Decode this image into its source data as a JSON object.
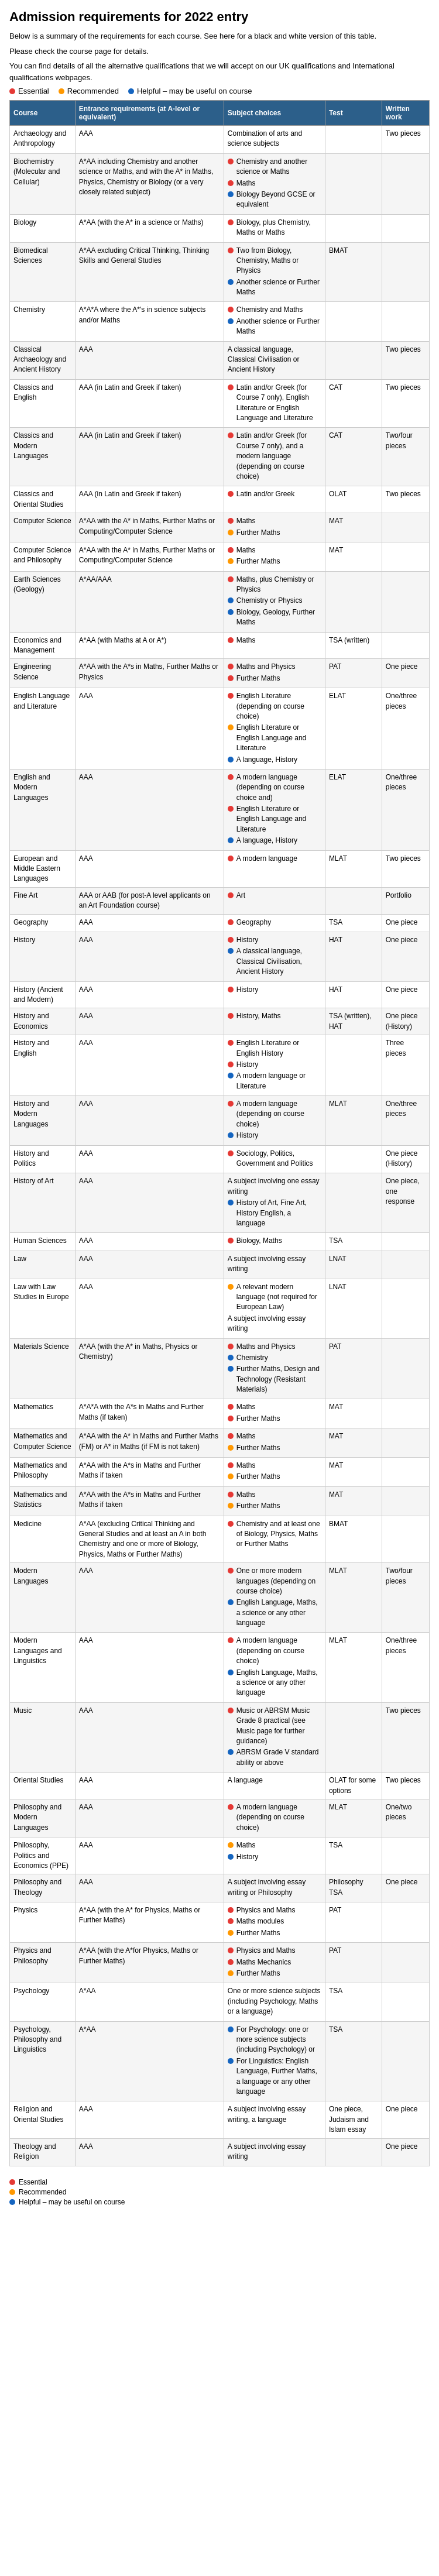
{
  "title": "Admission requirements for 2022 entry",
  "intro_lines": [
    "Below is a summary of the requirements for each course. See here for a black and white version of this table.",
    "Please check the course page for details.",
    "You can find details of all the alternative qualifications that we will accept on our UK qualifications and International qualifications webpages."
  ],
  "legend": [
    {
      "color": "red",
      "label": "Essential"
    },
    {
      "color": "orange",
      "label": "Recommended"
    },
    {
      "color": "blue",
      "label": "Helpful – may be useful on course"
    }
  ],
  "table_headers": [
    "Course",
    "Entrance requirements (at A-level or equivalent)",
    "Subject choices",
    "Test",
    "Written work"
  ],
  "rows_a": [
    {
      "course": "Archaeology and Anthropology",
      "entrance": "AAA",
      "subjects": [
        {
          "color": "none",
          "text": "Combination of arts and science subjects"
        }
      ],
      "test": "",
      "written": "Two pieces"
    },
    {
      "course": "Biochemistry (Molecular and Cellular)",
      "entrance": "A*AA including Chemistry and another science or Maths, and with the A* in Maths, Physics, Chemistry or Biology (or a very closely related subject)",
      "subjects": [
        {
          "color": "red",
          "text": "Chemistry and another science or Maths"
        },
        {
          "color": "red",
          "text": "Maths"
        },
        {
          "color": "blue",
          "text": "Biology Beyond GCSE or equivalent"
        }
      ],
      "test": "",
      "written": ""
    },
    {
      "course": "Biology",
      "entrance": "A*AA (with the A* in a science or Maths)",
      "subjects": [
        {
          "color": "red",
          "text": "Biology, plus Chemistry, Maths or Maths"
        }
      ],
      "test": "",
      "written": ""
    },
    {
      "course": "Biomedical Sciences",
      "entrance": "A*AA excluding Critical Thinking, Thinking Skills and General Studies",
      "subjects": [
        {
          "color": "red",
          "text": "Two from Biology, Chemistry, Maths or Physics"
        },
        {
          "color": "blue",
          "text": "Another science or Further Maths"
        }
      ],
      "test": "BMAT",
      "written": ""
    },
    {
      "course": "Chemistry",
      "entrance": "A*A*A where the A*'s in science subjects and/or Maths",
      "subjects": [
        {
          "color": "red",
          "text": "Chemistry and Maths"
        },
        {
          "color": "blue",
          "text": "Another science or Further Maths"
        }
      ],
      "test": "",
      "written": ""
    },
    {
      "course": "Classical Archaeology and Ancient History",
      "entrance": "AAA",
      "subjects": [
        {
          "color": "none",
          "text": "A classical language, Classical Civilisation or Ancient History"
        }
      ],
      "test": "",
      "written": "Two pieces"
    },
    {
      "course": "Classics and English",
      "entrance": "AAA (in Latin and Greek if taken)",
      "subjects": [
        {
          "color": "red",
          "text": "Latin and/or Greek (for Course 7 only), English Literature or English Language and Literature"
        }
      ],
      "test": "CAT",
      "written": "Two pieces"
    },
    {
      "course": "Classics and Modern Languages",
      "entrance": "AAA (in Latin and Greek if taken)",
      "subjects": [
        {
          "color": "red",
          "text": "Latin and/or Greek (for Course 7 only), and a modern language (depending on course choice)"
        }
      ],
      "test": "CAT",
      "written": "Two/four pieces"
    },
    {
      "course": "Classics and Oriental Studies",
      "entrance": "AAA (in Latin and Greek if taken)",
      "subjects": [
        {
          "color": "red",
          "text": "Latin and/or Greek"
        }
      ],
      "test": "OLAT",
      "written": "Two pieces"
    },
    {
      "course": "Computer Science",
      "entrance": "A*AA with the A* in Maths, Further Maths or Computing/Computer Science",
      "subjects": [
        {
          "color": "red",
          "text": "Maths"
        },
        {
          "color": "orange",
          "text": "Further Maths"
        }
      ],
      "test": "MAT",
      "written": ""
    },
    {
      "course": "Computer Science and Philosophy",
      "entrance": "A*AA with the A* in Maths, Further Maths or Computing/Computer Science",
      "subjects": [
        {
          "color": "red",
          "text": "Maths"
        },
        {
          "color": "orange",
          "text": "Further Maths"
        }
      ],
      "test": "MAT",
      "written": ""
    },
    {
      "course": "Earth Sciences (Geology)",
      "entrance": "A*AA/AAA",
      "subjects": [
        {
          "color": "red",
          "text": "Maths, plus Chemistry or Physics"
        },
        {
          "color": "blue",
          "text": "Chemistry or Physics"
        },
        {
          "color": "blue",
          "text": "Biology, Geology, Further Maths"
        }
      ],
      "test": "",
      "written": ""
    },
    {
      "course": "Economics and Management",
      "entrance": "A*AA (with Maths at A or A*)",
      "subjects": [
        {
          "color": "red",
          "text": "Maths"
        }
      ],
      "test": "TSA (written)",
      "written": ""
    },
    {
      "course": "Engineering Science",
      "entrance": "A*AA with the A*s in Maths, Further Maths or Physics",
      "subjects": [
        {
          "color": "red",
          "text": "Maths and Physics"
        },
        {
          "color": "red",
          "text": "Further Maths"
        }
      ],
      "test": "PAT",
      "written": "One piece"
    },
    {
      "course": "English Language and Literature",
      "entrance": "AAA",
      "subjects": [
        {
          "color": "red",
          "text": "English Literature (depending on course choice)"
        },
        {
          "color": "orange",
          "text": "English Literature or English Language and Literature"
        },
        {
          "color": "blue",
          "text": "A language, History"
        }
      ],
      "test": "ELAT",
      "written": "One/three pieces"
    },
    {
      "course": "English and Modern Languages",
      "entrance": "AAA",
      "subjects": [
        {
          "color": "red",
          "text": "A modern language (depending on course choice and)"
        },
        {
          "color": "red",
          "text": "English Literature or English Language and Literature"
        },
        {
          "color": "blue",
          "text": "A language, History"
        }
      ],
      "test": "ELAT",
      "written": "One/three pieces"
    },
    {
      "course": "European and Middle Eastern Languages",
      "entrance": "AAA",
      "subjects": [
        {
          "color": "red",
          "text": "A modern language"
        }
      ],
      "test": "MLAT",
      "written": "Two pieces"
    },
    {
      "course": "Fine Art",
      "entrance": "AAA or AAB (for post-A level applicants on an Art Foundation course)",
      "subjects": [
        {
          "color": "red",
          "text": "Art"
        }
      ],
      "test": "",
      "written": "Portfolio"
    },
    {
      "course": "Geography",
      "entrance": "AAA",
      "subjects": [
        {
          "color": "red",
          "text": "Geography"
        }
      ],
      "test": "TSA",
      "written": "One piece"
    },
    {
      "course": "History",
      "entrance": "AAA",
      "subjects": [
        {
          "color": "red",
          "text": "History"
        },
        {
          "color": "blue",
          "text": "A classical language, Classical Civilisation, Ancient History"
        }
      ],
      "test": "HAT",
      "written": "One piece"
    },
    {
      "course": "History (Ancient and Modern)",
      "entrance": "AAA",
      "subjects": [
        {
          "color": "red",
          "text": "History"
        }
      ],
      "test": "HAT",
      "written": "One piece"
    },
    {
      "course": "History and Economics",
      "entrance": "AAA",
      "subjects": [
        {
          "color": "red",
          "text": "History, Maths"
        }
      ],
      "test": "TSA (written), HAT",
      "written": "One piece (History)"
    },
    {
      "course": "History and English",
      "entrance": "AAA",
      "subjects": [
        {
          "color": "red",
          "text": "English Literature or English History"
        },
        {
          "color": "red",
          "text": "History"
        },
        {
          "color": "blue",
          "text": "A modern language or Literature"
        }
      ],
      "test": "",
      "written": "Three pieces"
    },
    {
      "course": "History and Modern Languages",
      "entrance": "AAA",
      "subjects": [
        {
          "color": "red",
          "text": "A modern language (depending on course choice)"
        },
        {
          "color": "blue",
          "text": "History"
        }
      ],
      "test": "MLAT",
      "written": "One/three pieces"
    },
    {
      "course": "History and Politics",
      "entrance": "AAA",
      "subjects": [
        {
          "color": "red",
          "text": "Sociology, Politics, Government and Politics"
        }
      ],
      "test": "",
      "written": "One piece (History)"
    },
    {
      "course": "History of Art",
      "entrance": "AAA",
      "subjects": [
        {
          "color": "none",
          "text": "A subject involving one essay writing"
        },
        {
          "color": "blue",
          "text": "History of Art, Fine Art, History English, a language"
        }
      ],
      "test": "",
      "written": "One piece, one response"
    },
    {
      "course": "Human Sciences",
      "entrance": "AAA",
      "subjects": [
        {
          "color": "red",
          "text": "Biology, Maths"
        }
      ],
      "test": "TSA",
      "written": ""
    }
  ],
  "rows_b": [
    {
      "course": "Law",
      "entrance": "AAA",
      "subjects": [
        {
          "color": "none",
          "text": "A subject involving essay writing"
        }
      ],
      "test": "LNAT",
      "written": ""
    },
    {
      "course": "Law with Law Studies in Europe",
      "entrance": "AAA",
      "subjects": [
        {
          "color": "orange",
          "text": "A relevant modern language (not required for European Law)"
        },
        {
          "color": "none",
          "text": "A subject involving essay writing"
        }
      ],
      "test": "LNAT",
      "written": ""
    },
    {
      "course": "Materials Science",
      "entrance": "A*AA (with the A* in Maths, Physics or Chemistry)",
      "subjects": [
        {
          "color": "red",
          "text": "Maths and Physics"
        },
        {
          "color": "blue",
          "text": "Chemistry"
        },
        {
          "color": "blue",
          "text": "Further Maths, Design and Technology (Resistant Materials)"
        }
      ],
      "test": "PAT",
      "written": ""
    },
    {
      "course": "Mathematics",
      "entrance": "A*A*A with the A*s in Maths and Further Maths (if taken)",
      "subjects": [
        {
          "color": "red",
          "text": "Maths"
        },
        {
          "color": "red",
          "text": "Further Maths"
        }
      ],
      "test": "MAT",
      "written": ""
    },
    {
      "course": "Mathematics and Computer Science",
      "entrance": "A*AA with the A* in Maths and Further Maths (FM) or A* in Maths (if FM is not taken)",
      "subjects": [
        {
          "color": "red",
          "text": "Maths"
        },
        {
          "color": "orange",
          "text": "Further Maths"
        }
      ],
      "test": "MAT",
      "written": ""
    },
    {
      "course": "Mathematics and Philosophy",
      "entrance": "A*AA with the A*s in Maths and Further Maths if taken",
      "subjects": [
        {
          "color": "red",
          "text": "Maths"
        },
        {
          "color": "orange",
          "text": "Further Maths"
        }
      ],
      "test": "MAT",
      "written": ""
    },
    {
      "course": "Mathematics and Statistics",
      "entrance": "A*AA with the A*s in Maths and Further Maths if taken",
      "subjects": [
        {
          "color": "red",
          "text": "Maths"
        },
        {
          "color": "orange",
          "text": "Further Maths"
        }
      ],
      "test": "MAT",
      "written": ""
    },
    {
      "course": "Medicine",
      "entrance": "A*AA (excluding Critical Thinking and General Studies and at least an A in both Chemistry and one or more of Biology, Physics, Maths or Further Maths)",
      "subjects": [
        {
          "color": "red",
          "text": "Chemistry and at least one of Biology, Physics, Maths or Further Maths"
        }
      ],
      "test": "BMAT",
      "written": ""
    },
    {
      "course": "Modern Languages",
      "entrance": "AAA",
      "subjects": [
        {
          "color": "red",
          "text": "One or more modern languages (depending on course choice)"
        },
        {
          "color": "blue",
          "text": "English Language, Maths, a science or any other language"
        }
      ],
      "test": "MLAT",
      "written": "Two/four pieces"
    },
    {
      "course": "Modern Languages and Linguistics",
      "entrance": "AAA",
      "subjects": [
        {
          "color": "red",
          "text": "A modern language (depending on course choice)"
        },
        {
          "color": "blue",
          "text": "English Language, Maths, a science or any other language"
        }
      ],
      "test": "MLAT",
      "written": "One/three pieces"
    },
    {
      "course": "Music",
      "entrance": "AAA",
      "subjects": [
        {
          "color": "red",
          "text": "Music or ABRSM Music Grade 8 practical (see Music page for further guidance)"
        },
        {
          "color": "blue",
          "text": "ABRSM Grade V standard ability or above"
        }
      ],
      "test": "",
      "written": "Two pieces"
    },
    {
      "course": "Oriental Studies",
      "entrance": "AAA",
      "subjects": [
        {
          "color": "none",
          "text": "A language"
        }
      ],
      "test": "OLAT for some options",
      "written": "Two pieces"
    },
    {
      "course": "Philosophy and Modern Languages",
      "entrance": "AAA",
      "subjects": [
        {
          "color": "red",
          "text": "A modern language (depending on course choice)"
        }
      ],
      "test": "MLAT",
      "written": "One/two pieces"
    },
    {
      "course": "Philosophy, Politics and Economics (PPE)",
      "entrance": "AAA",
      "subjects": [
        {
          "color": "orange",
          "text": "Maths"
        },
        {
          "color": "blue",
          "text": "History"
        }
      ],
      "test": "TSA",
      "written": ""
    },
    {
      "course": "Philosophy and Theology",
      "entrance": "AAA",
      "subjects": [
        {
          "color": "none",
          "text": "A subject involving essay writing or Philosophy"
        }
      ],
      "test": "Philosophy TSA",
      "written": "One piece"
    },
    {
      "course": "Physics",
      "entrance": "A*AA (with the A* for Physics, Maths or Further Maths)",
      "subjects": [
        {
          "color": "red",
          "text": "Physics and Maths"
        },
        {
          "color": "red",
          "text": "Maths modules"
        },
        {
          "color": "orange",
          "text": "Further Maths"
        }
      ],
      "test": "PAT",
      "written": ""
    },
    {
      "course": "Physics and Philosophy",
      "entrance": "A*AA (with the A*for Physics, Maths or Further Maths)",
      "subjects": [
        {
          "color": "red",
          "text": "Physics and Maths"
        },
        {
          "color": "red",
          "text": "Maths Mechanics"
        },
        {
          "color": "orange",
          "text": "Further Maths"
        }
      ],
      "test": "PAT",
      "written": ""
    },
    {
      "course": "Psychology",
      "entrance": "A*AA",
      "subjects": [
        {
          "color": "none",
          "text": "One or more science subjects (including Psychology, Maths or a language)"
        }
      ],
      "test": "TSA",
      "written": ""
    },
    {
      "course": "Psychology, Philosophy and Linguistics",
      "entrance": "A*AA",
      "subjects": [
        {
          "color": "blue",
          "text": "For Psychology: one or more science subjects (including Psychology) or"
        },
        {
          "color": "blue",
          "text": "For Linguistics: English Language, Further Maths, a language or any other language"
        }
      ],
      "test": "TSA",
      "written": ""
    },
    {
      "course": "Religion and Oriental Studies",
      "entrance": "AAA",
      "subjects": [
        {
          "color": "none",
          "text": "A subject involving essay writing, a language"
        }
      ],
      "test": "One piece, Judaism and Islam essay",
      "written": "One piece"
    },
    {
      "course": "Theology and Religion",
      "entrance": "AAA",
      "subjects": [
        {
          "color": "none",
          "text": "A subject involving essay writing"
        }
      ],
      "test": "",
      "written": "One piece"
    }
  ],
  "footer_legend": [
    {
      "color": "red",
      "label": "Essential"
    },
    {
      "color": "orange",
      "label": "Recommended"
    },
    {
      "color": "blue",
      "label": "Helpful – may be useful on course"
    }
  ]
}
